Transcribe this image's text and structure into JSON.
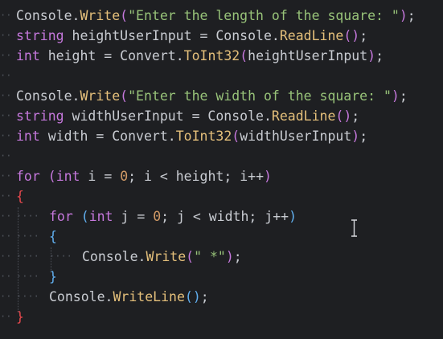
{
  "editor": {
    "colors": {
      "background": "#1e1f22",
      "default": "#c9ccd2",
      "keyword": "#c678dd",
      "method": "#e5c07b",
      "string": "#98c379",
      "number": "#d19a66",
      "brace_outer": "#e5484d",
      "brace_inner": "#61afef"
    },
    "lines": [
      {
        "indent": 0,
        "tokens": [
          {
            "t": "Console",
            "c": "default"
          },
          {
            "t": ".",
            "c": "punct"
          },
          {
            "t": "Write",
            "c": "fn"
          },
          {
            "t": "(",
            "c": "paren1"
          },
          {
            "t": "\"Enter the length of the square: \"",
            "c": "str"
          },
          {
            "t": ")",
            "c": "paren1"
          },
          {
            "t": ";",
            "c": "punct"
          }
        ]
      },
      {
        "indent": 0,
        "tokens": [
          {
            "t": "string",
            "c": "kw"
          },
          {
            "t": " heightUserInput ",
            "c": "default"
          },
          {
            "t": "=",
            "c": "op"
          },
          {
            "t": " Console",
            "c": "default"
          },
          {
            "t": ".",
            "c": "punct"
          },
          {
            "t": "ReadLine",
            "c": "fn"
          },
          {
            "t": "()",
            "c": "paren1"
          },
          {
            "t": ";",
            "c": "punct"
          }
        ]
      },
      {
        "indent": 0,
        "tokens": [
          {
            "t": "int",
            "c": "kw"
          },
          {
            "t": " height ",
            "c": "default"
          },
          {
            "t": "=",
            "c": "op"
          },
          {
            "t": " Convert",
            "c": "default"
          },
          {
            "t": ".",
            "c": "punct"
          },
          {
            "t": "ToInt32",
            "c": "fn"
          },
          {
            "t": "(",
            "c": "paren1"
          },
          {
            "t": "heightUserInput",
            "c": "default"
          },
          {
            "t": ")",
            "c": "paren1"
          },
          {
            "t": ";",
            "c": "punct"
          }
        ]
      },
      {
        "indent": 0,
        "tokens": []
      },
      {
        "indent": 0,
        "tokens": [
          {
            "t": "Console",
            "c": "default"
          },
          {
            "t": ".",
            "c": "punct"
          },
          {
            "t": "Write",
            "c": "fn"
          },
          {
            "t": "(",
            "c": "paren1"
          },
          {
            "t": "\"Enter the width of the square: \"",
            "c": "str"
          },
          {
            "t": ")",
            "c": "paren1"
          },
          {
            "t": ";",
            "c": "punct"
          }
        ]
      },
      {
        "indent": 0,
        "tokens": [
          {
            "t": "string",
            "c": "kw"
          },
          {
            "t": " widthUserInput ",
            "c": "default"
          },
          {
            "t": "=",
            "c": "op"
          },
          {
            "t": " Console",
            "c": "default"
          },
          {
            "t": ".",
            "c": "punct"
          },
          {
            "t": "ReadLine",
            "c": "fn"
          },
          {
            "t": "()",
            "c": "paren1"
          },
          {
            "t": ";",
            "c": "punct"
          }
        ]
      },
      {
        "indent": 0,
        "tokens": [
          {
            "t": "int",
            "c": "kw"
          },
          {
            "t": " width ",
            "c": "default"
          },
          {
            "t": "=",
            "c": "op"
          },
          {
            "t": " Convert",
            "c": "default"
          },
          {
            "t": ".",
            "c": "punct"
          },
          {
            "t": "ToInt32",
            "c": "fn"
          },
          {
            "t": "(",
            "c": "paren1"
          },
          {
            "t": "widthUserInput",
            "c": "default"
          },
          {
            "t": ")",
            "c": "paren1"
          },
          {
            "t": ";",
            "c": "punct"
          }
        ]
      },
      {
        "indent": 0,
        "tokens": []
      },
      {
        "indent": 0,
        "tokens": [
          {
            "t": "for",
            "c": "kw"
          },
          {
            "t": " ",
            "c": "default"
          },
          {
            "t": "(",
            "c": "paren1"
          },
          {
            "t": "int",
            "c": "kw"
          },
          {
            "t": " i ",
            "c": "default"
          },
          {
            "t": "=",
            "c": "op"
          },
          {
            "t": " ",
            "c": "default"
          },
          {
            "t": "0",
            "c": "num"
          },
          {
            "t": "; i ",
            "c": "default"
          },
          {
            "t": "<",
            "c": "op"
          },
          {
            "t": " height; i",
            "c": "default"
          },
          {
            "t": "++",
            "c": "op"
          },
          {
            "t": ")",
            "c": "paren1"
          }
        ]
      },
      {
        "indent": 0,
        "tokens": [
          {
            "t": "{",
            "c": "brace1"
          }
        ]
      },
      {
        "indent": 1,
        "tokens": [
          {
            "t": "for",
            "c": "kw"
          },
          {
            "t": " ",
            "c": "default"
          },
          {
            "t": "(",
            "c": "paren2"
          },
          {
            "t": "int",
            "c": "kw"
          },
          {
            "t": " j ",
            "c": "default"
          },
          {
            "t": "=",
            "c": "op"
          },
          {
            "t": " ",
            "c": "default"
          },
          {
            "t": "0",
            "c": "num"
          },
          {
            "t": "; j ",
            "c": "default"
          },
          {
            "t": "<",
            "c": "op"
          },
          {
            "t": " width; j",
            "c": "default"
          },
          {
            "t": "++",
            "c": "op"
          },
          {
            "t": ")",
            "c": "paren2"
          }
        ]
      },
      {
        "indent": 1,
        "tokens": [
          {
            "t": "{",
            "c": "brace2"
          }
        ]
      },
      {
        "indent": 2,
        "tokens": [
          {
            "t": "Console",
            "c": "default"
          },
          {
            "t": ".",
            "c": "punct"
          },
          {
            "t": "Write",
            "c": "fn"
          },
          {
            "t": "(",
            "c": "paren1"
          },
          {
            "t": "\" *\"",
            "c": "str"
          },
          {
            "t": ")",
            "c": "paren1"
          },
          {
            "t": ";",
            "c": "punct"
          }
        ]
      },
      {
        "indent": 1,
        "tokens": [
          {
            "t": "}",
            "c": "brace2"
          }
        ]
      },
      {
        "indent": 1,
        "tokens": [
          {
            "t": "Console",
            "c": "default"
          },
          {
            "t": ".",
            "c": "punct"
          },
          {
            "t": "WriteLine",
            "c": "fn"
          },
          {
            "t": "()",
            "c": "paren2"
          },
          {
            "t": ";",
            "c": "punct"
          }
        ]
      },
      {
        "indent": 0,
        "tokens": [
          {
            "t": "}",
            "c": "brace1"
          }
        ]
      }
    ]
  }
}
